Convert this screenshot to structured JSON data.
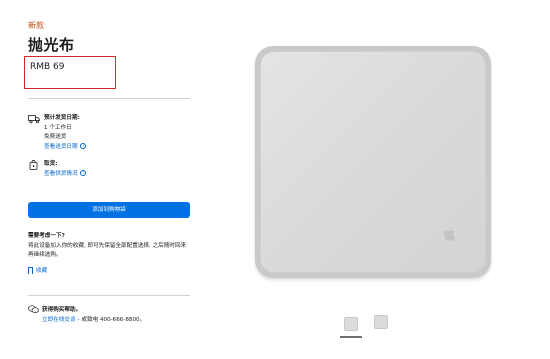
{
  "product": {
    "badge": "新款",
    "title": "抛光布",
    "price": "RMB 69"
  },
  "delivery": {
    "heading": "预计发货日期:",
    "eta": "1 个工作日",
    "shipping": "免费送货",
    "link": "查看送货日期"
  },
  "pickup": {
    "heading": "取货:",
    "link": "查看供货情况"
  },
  "cta": {
    "add_to_bag": "添加到购物袋"
  },
  "consider": {
    "heading": "需要考虑一下?",
    "body": "将此设备加入你的收藏, 即可先保留全部配置选择, 之后随时回来再继续选购。",
    "save_link": "收藏"
  },
  "help": {
    "heading": "获得购买帮助。",
    "chat_link": "立即在线交谈",
    "phone_text": "或致电 400-666-8800。"
  },
  "colors": {
    "accent": "#0071e3",
    "link": "#0066cc",
    "badge": "#bf4800",
    "highlight_box": "#d2282e"
  },
  "icons": {
    "delivery": "truck-icon",
    "pickup": "store-bag-icon",
    "help": "chat-bubble-icon",
    "save": "bookmark-icon",
    "logo": "apple-logo"
  }
}
